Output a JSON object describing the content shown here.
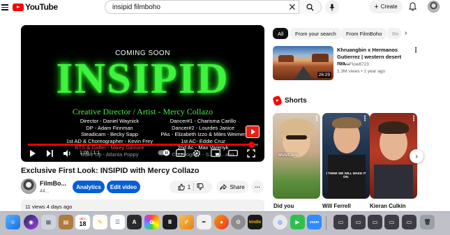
{
  "app": {
    "logo_text": "YouTube"
  },
  "search": {
    "query": "insipid filmboho",
    "placeholder": "Search"
  },
  "header": {
    "create_label": "Create",
    "create_plus": "+"
  },
  "player": {
    "coming_soon": "COMING SOON",
    "big_title": "INSIPID",
    "creative_director": "Creative Director / Artist - Mercy Collazo",
    "credits_left": [
      {
        "text": "Director - Daniel Waynick",
        "style": "normal"
      },
      {
        "text": "DP - Adam Finnman",
        "style": "normal"
      },
      {
        "text": "Steadicam - Becky Sapp",
        "style": "normal"
      },
      {
        "text": "1st AD & Choreographer - Kevin Frey",
        "style": "normal"
      },
      {
        "text": "BTS & Gaffer - Mikey Gilmore",
        "style": "red"
      },
      {
        "text": "Make Up - Atlanta Poppy",
        "style": "dim"
      }
    ],
    "credits_right": [
      {
        "text": "Dancer#1 - Charisma Carillo",
        "style": "normal"
      },
      {
        "text": "Dancer#2 - Lourdes Janice",
        "style": "normal"
      },
      {
        "text": "PAs - Elizabeth Izzo & Miles Weimer",
        "style": "normal"
      },
      {
        "text": "1st AC- Eddie Cruz",
        "style": "normal"
      },
      {
        "text": "2nd Ac - Max Varenyk",
        "style": "normal"
      },
      {
        "text": "Choreogra... - S... Vo...ano",
        "style": "dim"
      }
    ],
    "time": "1:06 / 1:1",
    "progress_fraction": 0.97
  },
  "video": {
    "title": "Exclusive First Look: INSIPID with Mercy Collazo",
    "channel_name": "FilmBo...",
    "channel_subs": "44...",
    "analytics_label": "Analytics",
    "edit_label": "Edit video",
    "like_count": "1",
    "share_label": "Share",
    "views_time": "11 views  4 days ago"
  },
  "chips": [
    "All",
    "From your search",
    "From FilmBoho",
    "Re"
  ],
  "recommendation": {
    "title": "Khruangbin x Hermanos Gutierrez | western desert roa...",
    "channel": "ActiveFlow8723",
    "meta": "1.3M views • 1 year ago",
    "duration": "26:29"
  },
  "shorts": {
    "heading": "Shorts",
    "items": [
      {
        "label": "Did you",
        "caption": "MUSICIAN,"
      },
      {
        "label": "Will Ferrell",
        "caption": "I THINK WE WILL MAKE IT ON."
      },
      {
        "label": "Kieran Culkin",
        "caption": ""
      }
    ]
  },
  "dock": {
    "kindle_label": "kindle",
    "zoom_label": "zoom",
    "calendar_month": "DEC",
    "calendar_day": "18"
  },
  "colors": {
    "brand_red": "#ff0000",
    "accent_blue": "#065fd4",
    "neon_green": "#3ef23e"
  }
}
